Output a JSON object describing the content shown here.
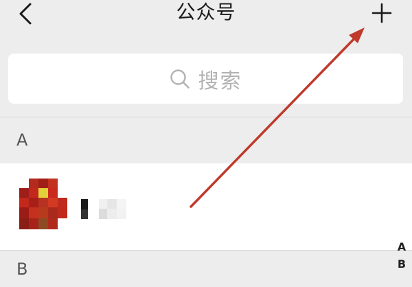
{
  "navbar": {
    "title": "公众号",
    "back_icon": "chevron-left-icon",
    "add_icon": "plus-icon"
  },
  "search": {
    "placeholder": "搜索",
    "icon": "search-icon"
  },
  "sections": [
    {
      "letter": "A",
      "items": [
        {
          "name": "",
          "avatar": "blurred-avatar"
        }
      ]
    },
    {
      "letter": "B",
      "items": []
    }
  ],
  "index_bar": [
    "A",
    "B"
  ],
  "annotation": {
    "color": "#c0392b"
  },
  "colors": {
    "background": "#ededed",
    "card": "#ffffff",
    "text_primary": "#1a1a1a",
    "placeholder": "#b2b2b2"
  }
}
